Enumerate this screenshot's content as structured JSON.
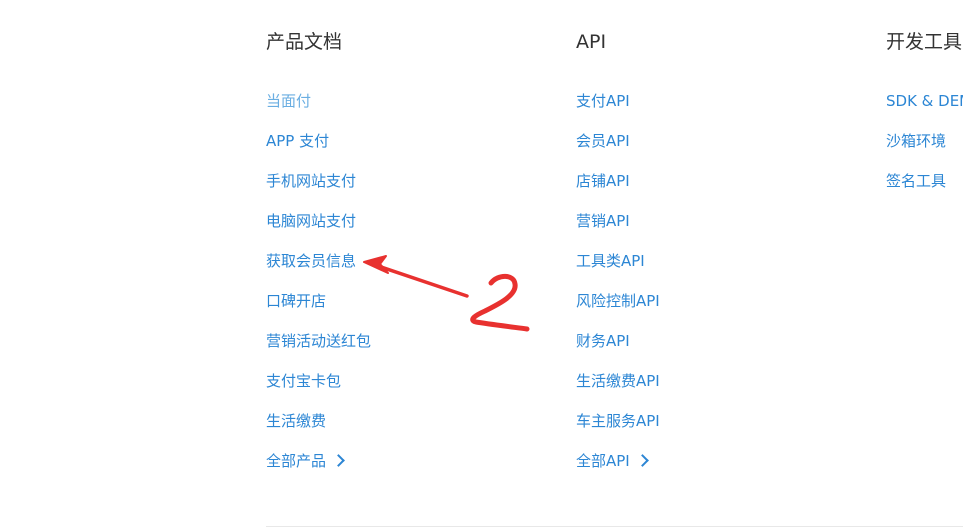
{
  "columns": {
    "products": {
      "title": "产品文档",
      "items": [
        "当面付",
        "APP 支付",
        "手机网站支付",
        "电脑网站支付",
        "获取会员信息",
        "口碑开店",
        "营销活动送红包",
        "支付宝卡包",
        "生活缴费"
      ],
      "more_label": "全部产品"
    },
    "api": {
      "title": "API",
      "items": [
        "支付API",
        "会员API",
        "店铺API",
        "营销API",
        "工具类API",
        "风险控制API",
        "财务API",
        "生活缴费API",
        "车主服务API"
      ],
      "more_label": "全部API"
    },
    "tools": {
      "title": "开发工具",
      "items": [
        "SDK & DEMO",
        "沙箱环境",
        "签名工具"
      ]
    }
  },
  "annotation": {
    "color": "#e8312f",
    "handwritten_digit": "2"
  },
  "colors": {
    "link": "#2c86d4",
    "link_muted": "#6aaee2",
    "heading": "#333333"
  }
}
